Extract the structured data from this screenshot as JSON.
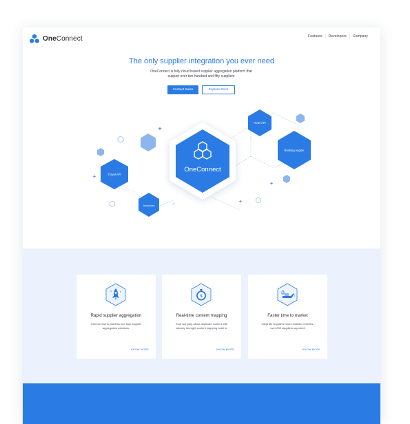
{
  "brand": {
    "name_bold": "One",
    "name_light": "Connect",
    "color": "#2b7be4"
  },
  "nav": {
    "items": [
      "Features",
      "Developers",
      "Company"
    ]
  },
  "hero": {
    "title": "The only supplier integration you ever need",
    "subtitle_line1": "OneConnect is fully cloud based supplier aggregation platform that",
    "subtitle_line2": "support over two hundred and fifty suppliers",
    "primary_button": "Contact Sales",
    "secondary_button": "Explore Docs"
  },
  "diagram": {
    "center_label": "OneConnect",
    "nodes": [
      "Hotel API",
      "Booking engine",
      "Travel API",
      "Inventory"
    ]
  },
  "features": [
    {
      "icon": "rocket-icon",
      "title": "Rapid supplier aggregation",
      "desc_line1": "OneConnect is painless one stop supplier",
      "desc_line2": "aggregation solutions.",
      "link": "KNOW MORE"
    },
    {
      "icon": "stopwatch-icon",
      "title": "Real-time content mapping",
      "desc_line1": "Stop worrying about duplicate content with",
      "desc_line2": "industry strenght content mapping build in.",
      "link": "KNOW MORE"
    },
    {
      "icon": "oil-can-icon",
      "title": "Faster time to market",
      "desc_line1": "Integrate suppliers hours instead of weeks,",
      "desc_line2": "over 250  suppliers suported!",
      "link": "KNOW MORE"
    }
  ]
}
